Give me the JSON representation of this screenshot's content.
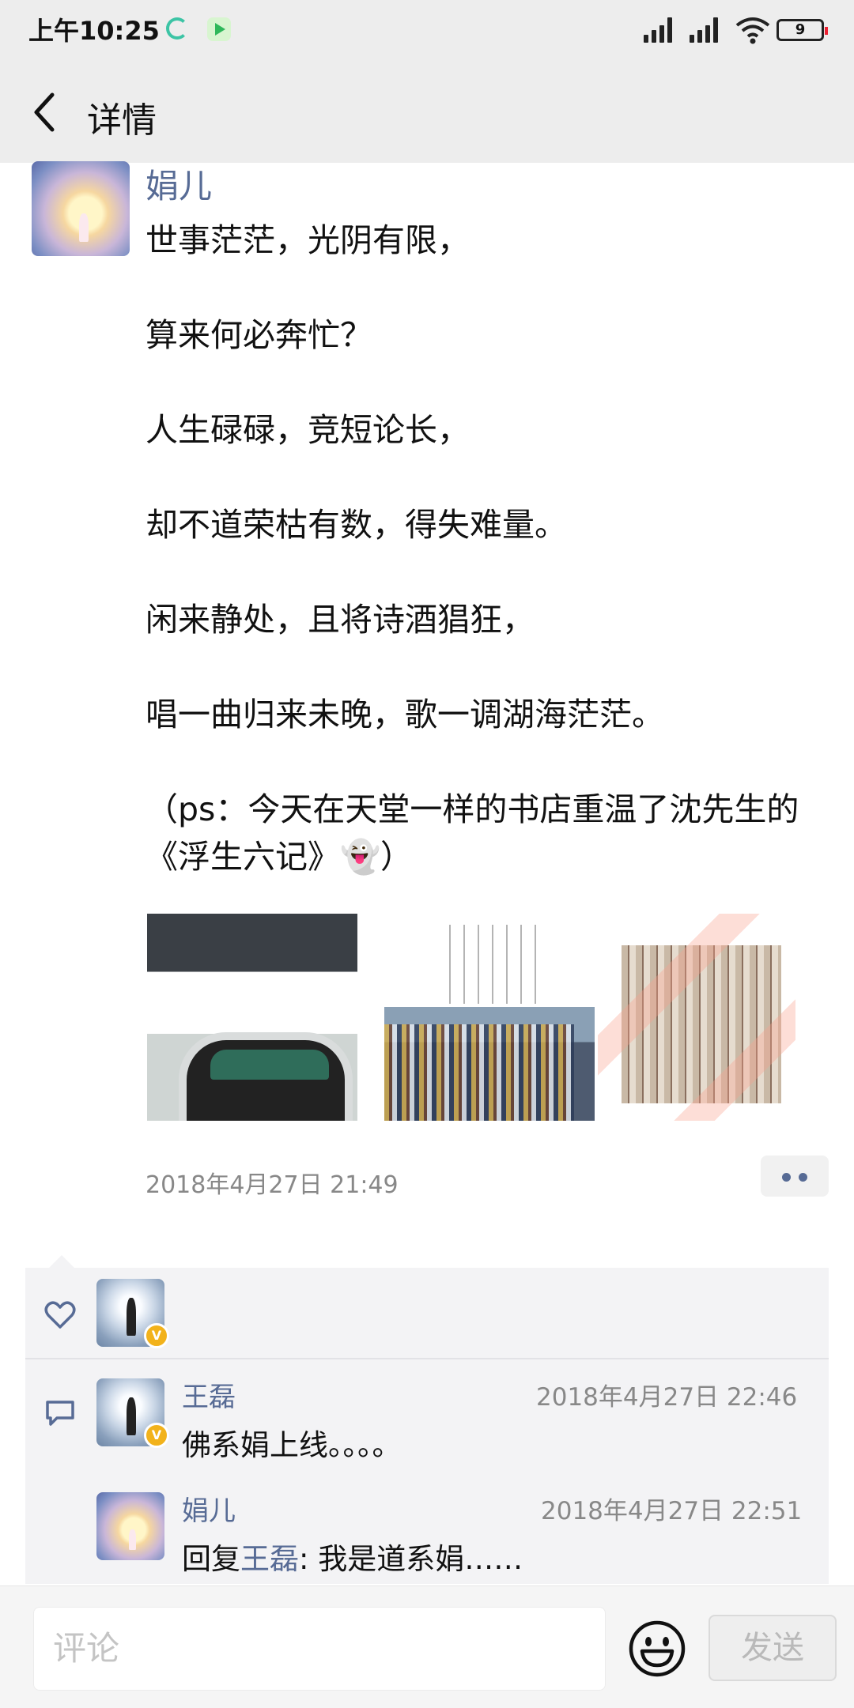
{
  "status_bar": {
    "time": "上午10:25",
    "battery": "9",
    "icons": [
      "sync-app-icon",
      "video-app-icon",
      "signal-1-icon",
      "signal-2-icon",
      "wifi-icon",
      "battery-icon"
    ]
  },
  "header": {
    "title": "详情",
    "back_icon": "chevron-left-icon"
  },
  "post": {
    "author": "娟儿",
    "text": "世事茫茫，光阴有限，\n\n算来何必奔忙？\n\n人生碌碌，竞短论长，\n\n却不道荣枯有数，得失难量。\n\n闲来静处，且将诗酒猖狂，\n\n唱一曲归来未晚，歌一调湖海茫茫。\n\n（ps：今天在天堂一样的书店重温了沈先生的《浮生六记》👻）",
    "images": [
      "bookstore-photo-1",
      "bookstore-photo-2",
      "bookstore-photo-3"
    ],
    "timestamp": "2018年4月27日 21:49"
  },
  "likes": {
    "icon": "heart-icon",
    "verified_badge": "V"
  },
  "comments": [
    {
      "author": "王磊",
      "time": "2018年4月27日 22:46",
      "text": "佛系娟上线。。。。",
      "verified_badge": "V"
    },
    {
      "author": "娟儿",
      "time": "2018年4月27日 22:51",
      "reply_prefix": "回复",
      "reply_to": "王磊",
      "text": ": 我是道系娟……"
    }
  ],
  "input_bar": {
    "placeholder": "评论",
    "emoji_icon": "smiley-icon",
    "send_label": "发送"
  },
  "colors": {
    "link_blue": "#576b95",
    "bar_gray": "#ededed",
    "comment_bg": "#f3f3f5"
  }
}
